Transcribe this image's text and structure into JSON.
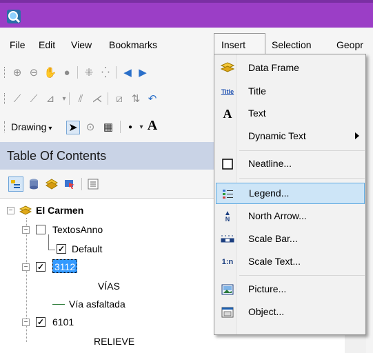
{
  "app": {
    "icon": "arcmap-globe-icon"
  },
  "menubar": {
    "items": [
      "File",
      "Edit",
      "View",
      "Bookmarks",
      "Insert",
      "Selection",
      "Geopr"
    ]
  },
  "drawing_toolbar": {
    "drawing_label": "Drawing",
    "font_glyph": "A"
  },
  "toc": {
    "title": "Table Of Contents",
    "tree": {
      "dataframe": "El Carmen",
      "anno_group": "TextosAnno",
      "anno_class": "Default",
      "layer1": "3112",
      "layer1_heading": "VÍAS",
      "layer1_class": "Vía asfaltada",
      "layer2": "6101",
      "layer2_heading": "RELIEVE"
    }
  },
  "insert_menu": {
    "items": [
      {
        "label": "Data Frame",
        "icon": "data-frame-icon"
      },
      {
        "label": "Title",
        "icon": "title-icon",
        "icon_text": "Title"
      },
      {
        "label": "Text",
        "icon": "text-icon",
        "icon_text": "A"
      },
      {
        "label": "Dynamic Text",
        "icon": "none",
        "submenu": true
      },
      {
        "label": "Neatline...",
        "icon": "neatline-icon"
      },
      {
        "label": "Legend...",
        "icon": "legend-icon",
        "highlighted": true
      },
      {
        "label": "North Arrow...",
        "icon": "north-arrow-icon",
        "icon_text": "N"
      },
      {
        "label": "Scale Bar...",
        "icon": "scale-bar-icon"
      },
      {
        "label": "Scale Text...",
        "icon": "scale-text-icon",
        "icon_text": "1:n"
      },
      {
        "label": "Picture...",
        "icon": "picture-icon"
      },
      {
        "label": "Object...",
        "icon": "object-icon"
      }
    ]
  },
  "colors": {
    "titlebar": "#9b3ec6",
    "toc_header": "#c9d3e6",
    "highlight": "#cde5f7",
    "selection": "#3399ff"
  }
}
